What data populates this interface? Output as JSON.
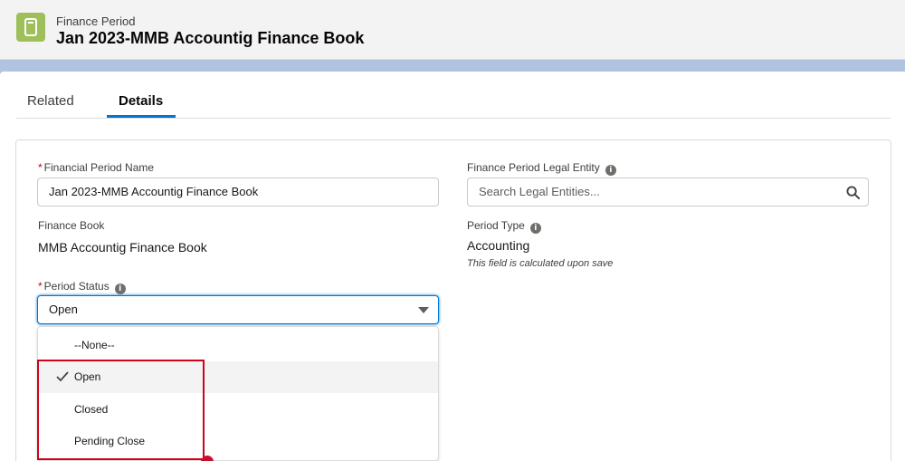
{
  "header": {
    "object_label": "Finance Period",
    "record_title": "Jan 2023-MMB Accountig Finance Book",
    "icon": "finance-period-icon",
    "icon_color": "#9ebf5a"
  },
  "tabs": [
    {
      "label": "Related",
      "active": false
    },
    {
      "label": "Details",
      "active": true
    }
  ],
  "fields": {
    "financial_period_name": {
      "required_marker": "*",
      "label": "Financial Period Name",
      "value": "Jan 2023-MMB Accountig Finance Book"
    },
    "legal_entity": {
      "label": "Finance Period Legal Entity",
      "placeholder": "Search Legal Entities..."
    },
    "finance_book": {
      "label": "Finance Book",
      "value": "MMB Accountig Finance Book"
    },
    "period_type": {
      "label": "Period Type",
      "value": "Accounting",
      "note": "This field is calculated upon save"
    },
    "period_status": {
      "required_marker": "*",
      "label": "Period Status",
      "value": "Open",
      "options": [
        "--None--",
        "Open",
        "Closed",
        "Pending Close"
      ],
      "selected_option": "Open"
    }
  },
  "colors": {
    "accent": "#0176d3",
    "annotation": "#d0021b",
    "required": "#ba0517"
  }
}
